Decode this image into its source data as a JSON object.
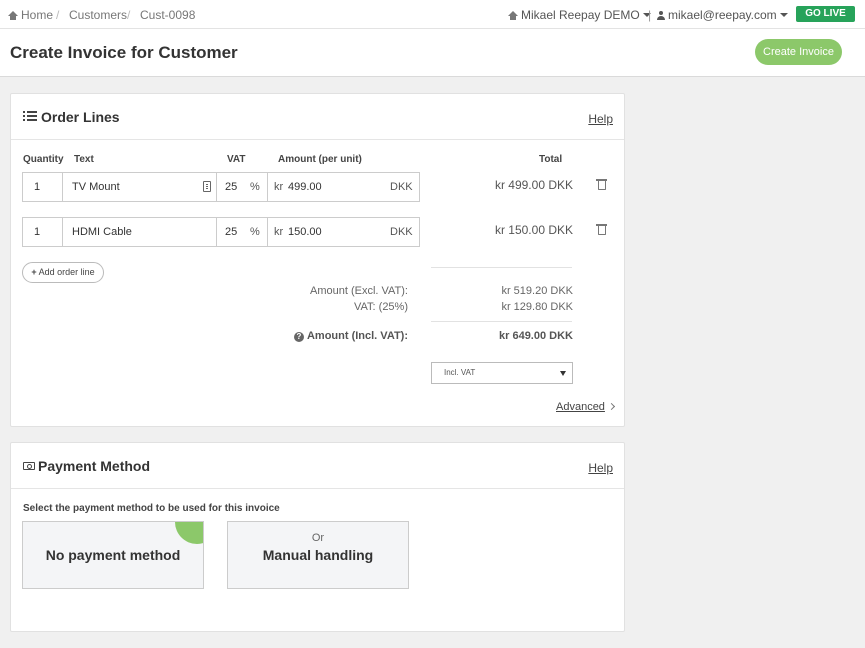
{
  "breadcrumb": {
    "home": "Home",
    "customers": "Customers",
    "current": "Cust-0098",
    "sep": "/"
  },
  "account": {
    "org": "Mikael Reepay DEMO",
    "email": "mikael@reepay.com",
    "divider": "|"
  },
  "go_live_label": "GO LIVE",
  "page_title": "Create Invoice for Customer",
  "create_invoice_label": "Create Invoice",
  "order_lines": {
    "title": "Order Lines",
    "help": "Help",
    "columns": {
      "quantity": "Quantity",
      "text": "Text",
      "vat": "VAT",
      "amount": "Amount (per unit)",
      "total": "Total"
    },
    "rows": [
      {
        "quantity": "1",
        "text": "TV Mount",
        "vat": "25",
        "vat_unit": "%",
        "currency_prefix": "kr",
        "amount": "499.00",
        "currency": "DKK",
        "total": "kr 499.00 DKK"
      },
      {
        "quantity": "1",
        "text": "HDMI Cable",
        "vat": "25",
        "vat_unit": "%",
        "currency_prefix": "kr",
        "amount": "150.00",
        "currency": "DKK",
        "total": "kr 150.00 DKK"
      }
    ],
    "add_line_label": "Add order line",
    "summary": {
      "excl_label": "Amount (Excl. VAT):",
      "excl_value": "kr 519.20 DKK",
      "vat_label": "VAT: (25%)",
      "vat_value": "kr 129.80 DKK",
      "incl_label": "Amount (Incl. VAT):",
      "incl_value": "kr 649.00 DKK"
    },
    "vat_mode_selected": "Incl. VAT",
    "advanced_label": "Advanced"
  },
  "payment_method": {
    "title": "Payment Method",
    "help": "Help",
    "subtitle": "Select the payment method to be used for this invoice",
    "options": [
      {
        "label": "No payment method",
        "selected": true
      },
      {
        "or": "Or",
        "label": "Manual handling",
        "selected": false
      }
    ]
  },
  "colors": {
    "accent_green": "#8cc86a",
    "go_live_green": "#27a35a"
  }
}
